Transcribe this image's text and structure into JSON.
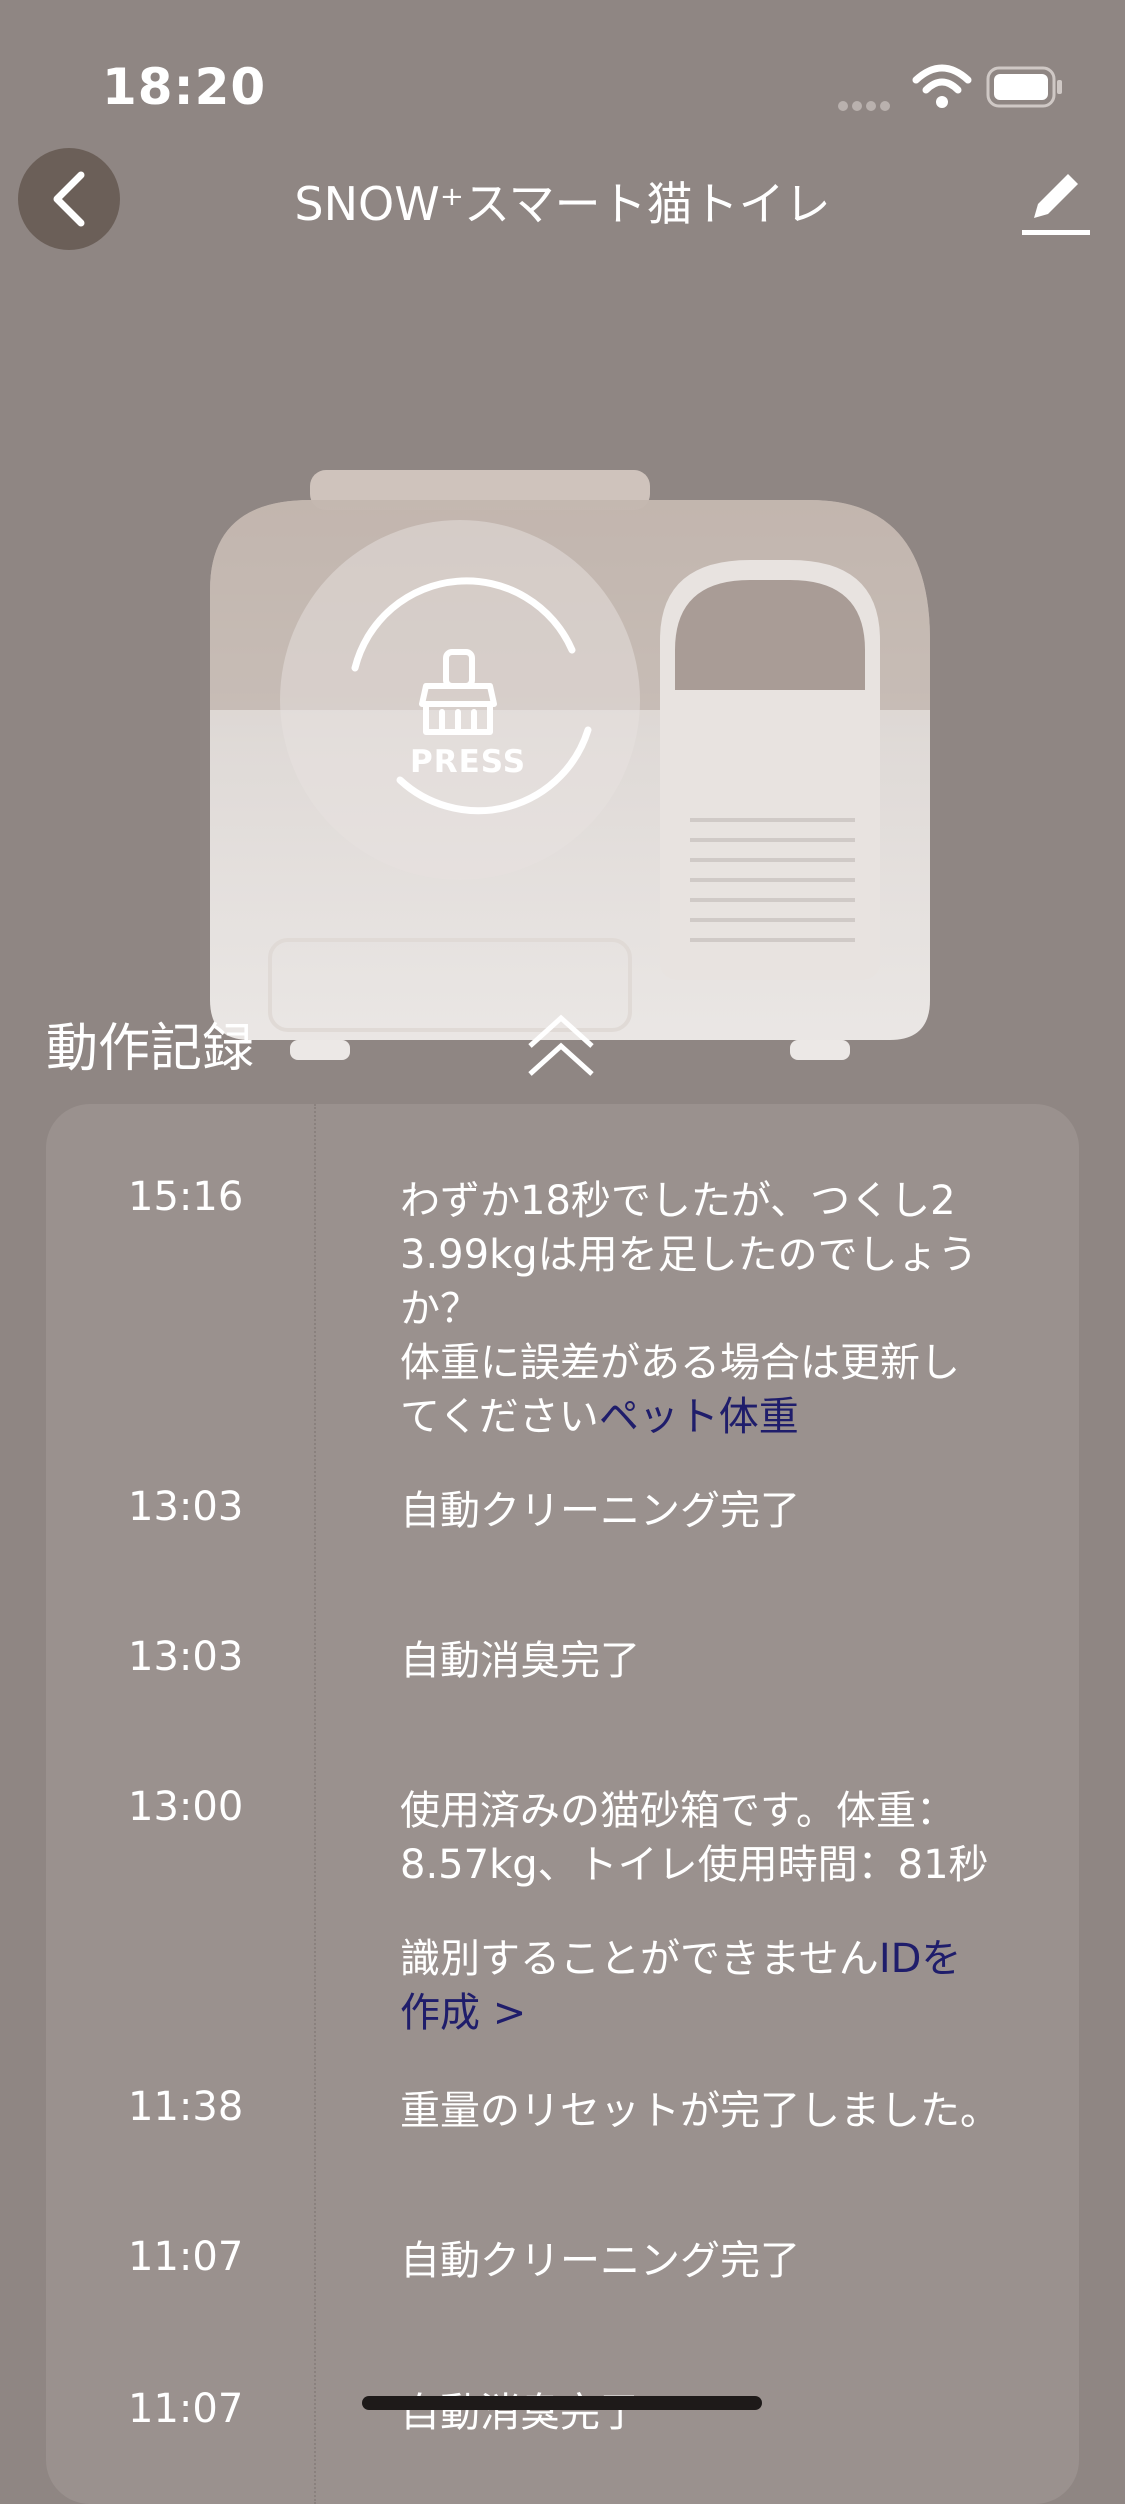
{
  "status_bar": {
    "time": "18:20"
  },
  "nav": {
    "title": "SNOW⁺スマート猫トイレ"
  },
  "device": {
    "press_label": "PRESS"
  },
  "section": {
    "title": "動作記録"
  },
  "log": [
    {
      "time": "15:16",
      "lines": [
        "わずか18秒でしたが、つくし2",
        "3.99kgは用を足したのでしょう",
        "か？",
        "体重に誤差がある場合は更新し"
      ],
      "last_line_prefix": "てください",
      "last_line_link": "ペット体重"
    },
    {
      "time": "13:03",
      "text": "自動クリーニング完了"
    },
    {
      "time": "13:03",
      "text": "自動消臭完了"
    },
    {
      "time": "13:00",
      "lines": [
        "使用済みの猫砂箱です。体重：",
        "8.57kg、トイレ使用時間：81秒"
      ],
      "note_prefix": "識別することができません",
      "note_link_1": "IDを",
      "note_link_2": "作成 >"
    },
    {
      "time": "11:38",
      "text": "重量のリセットが完了しました。"
    },
    {
      "time": "11:07",
      "text": "自動クリーニング完了"
    },
    {
      "time": "11:07",
      "text": "自動消臭完了"
    }
  ]
}
